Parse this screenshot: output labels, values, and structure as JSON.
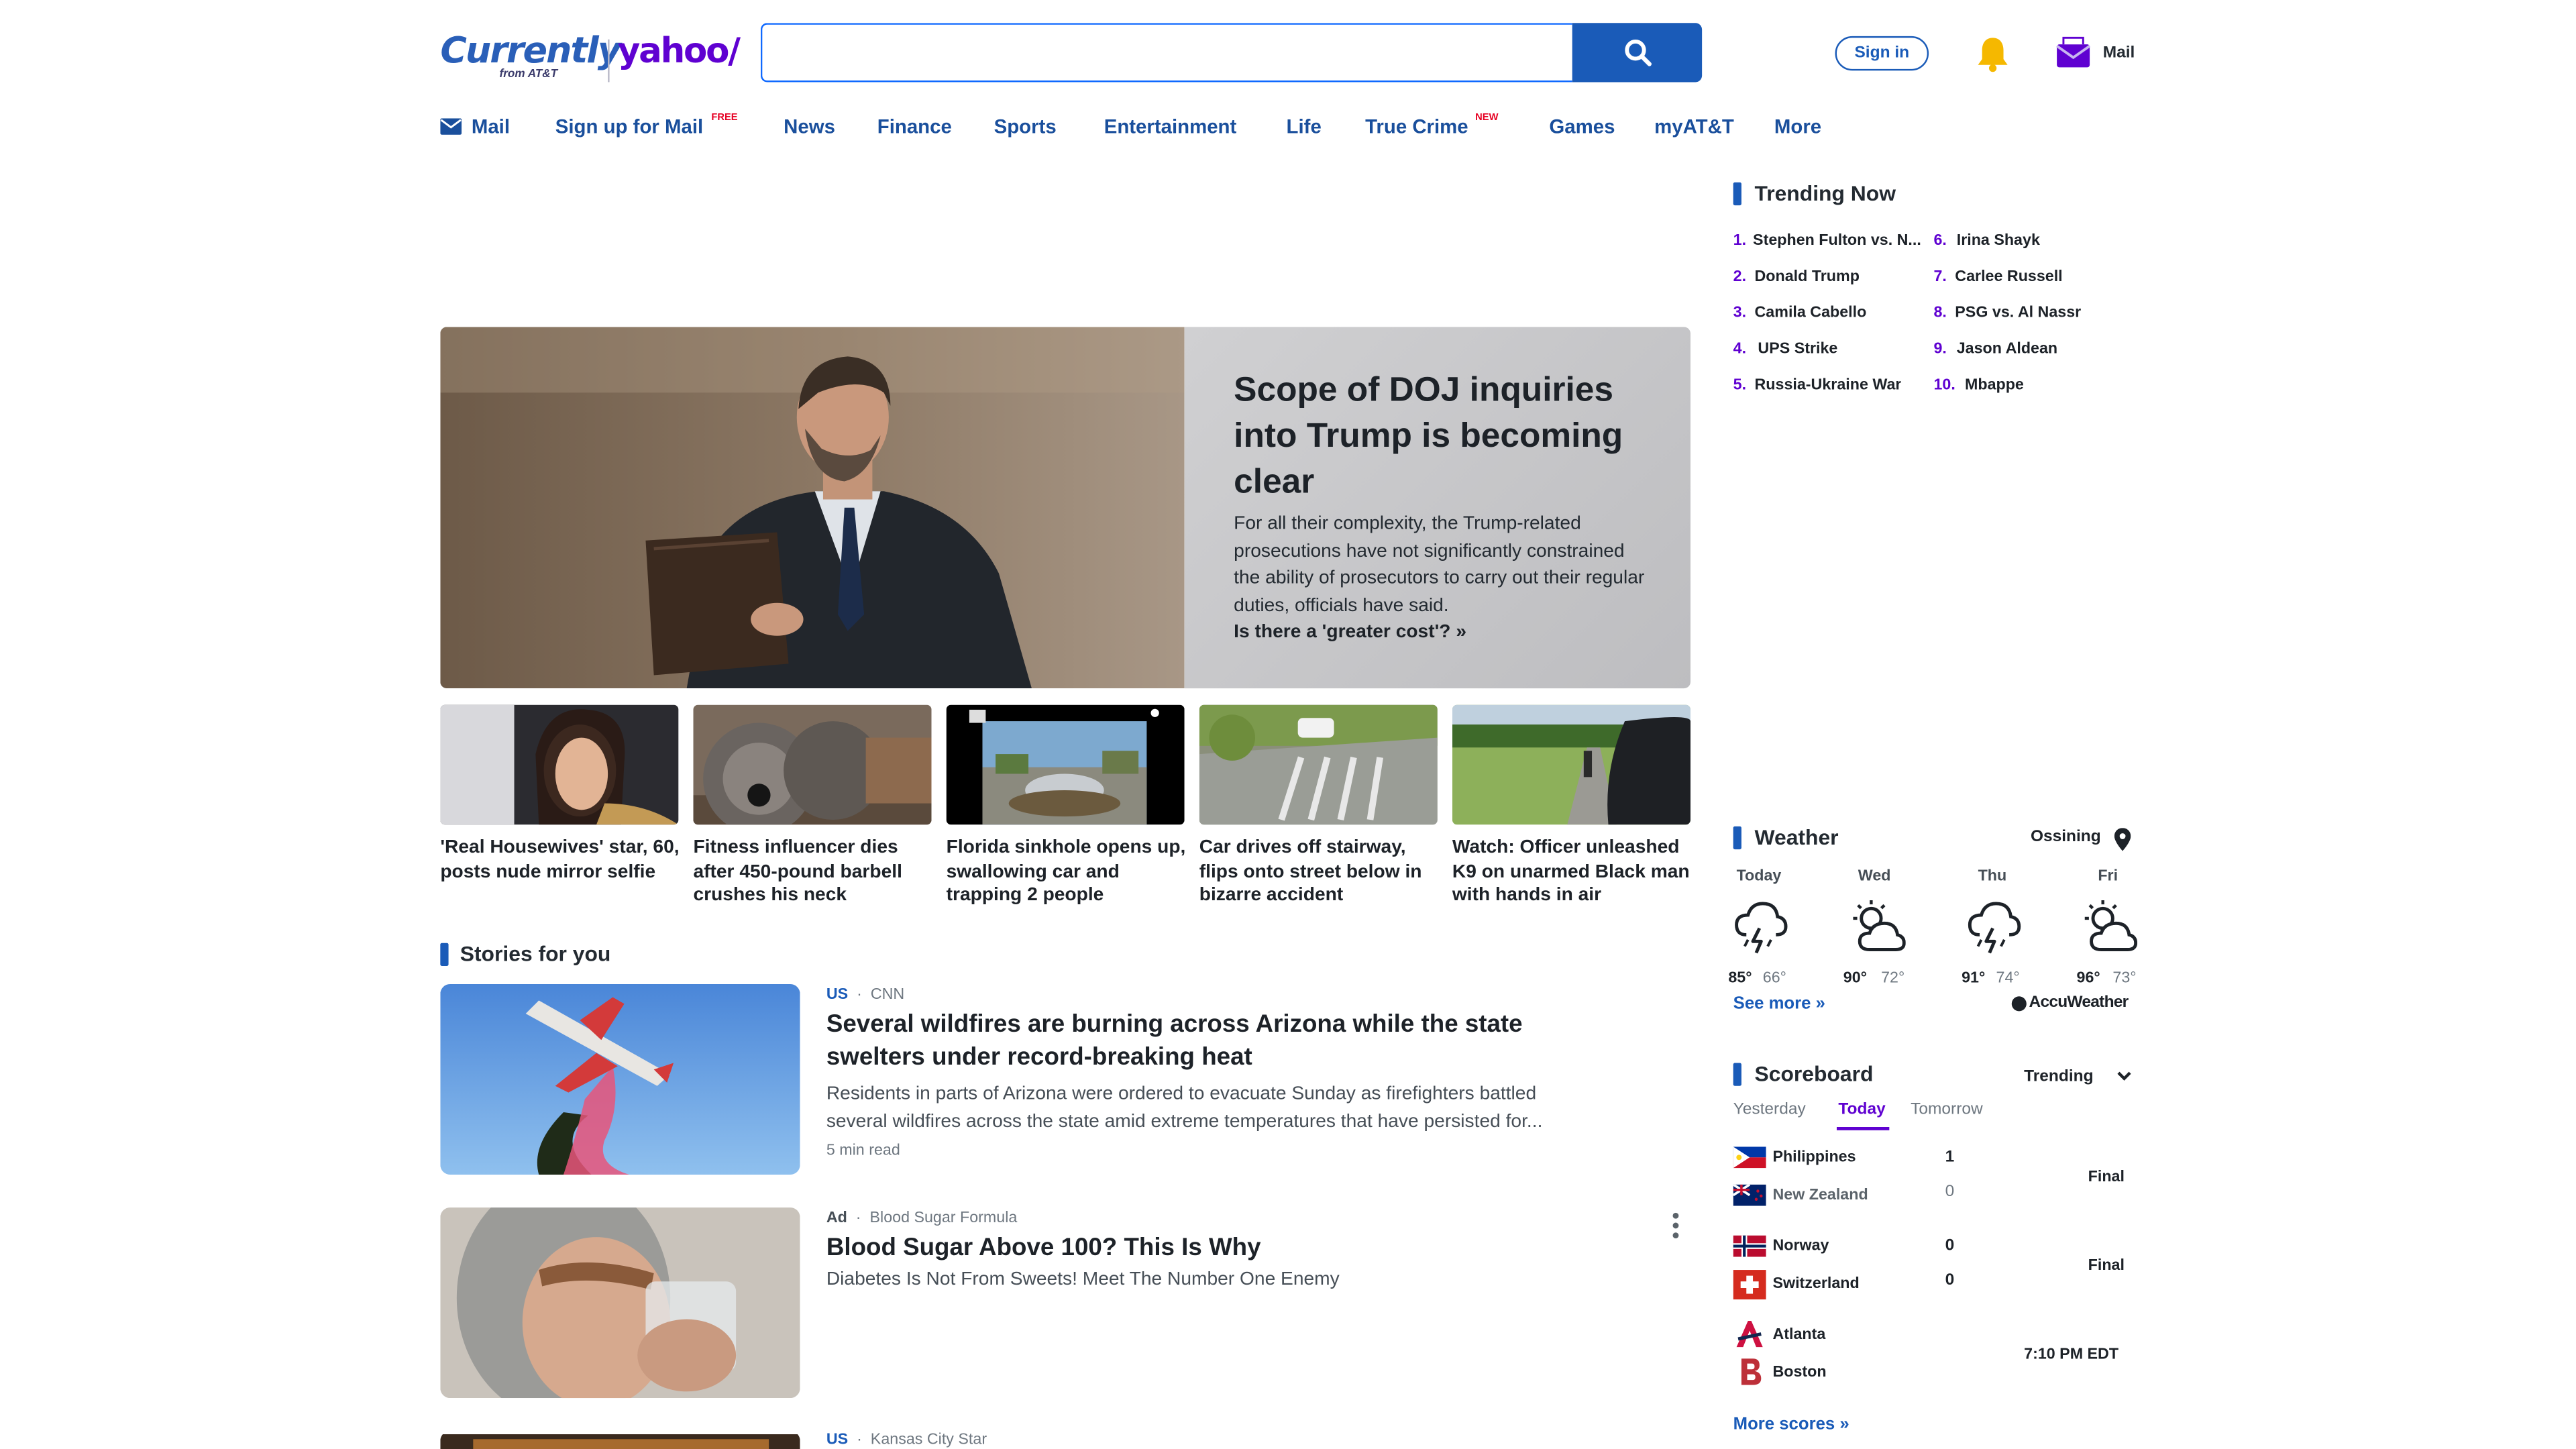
{
  "header": {
    "logo_currently": "Currently",
    "logo_att": "from AT&T",
    "logo_yahoo": "yahoo/",
    "search_placeholder": "",
    "signin_label": "Sign in",
    "mail_label": "Mail"
  },
  "nav": {
    "items": [
      {
        "label": "Mail"
      },
      {
        "label": "Sign up for Mail",
        "badge": "FREE"
      },
      {
        "label": "News"
      },
      {
        "label": "Finance"
      },
      {
        "label": "Sports"
      },
      {
        "label": "Entertainment"
      },
      {
        "label": "Life"
      },
      {
        "label": "True Crime",
        "badge": "NEW"
      },
      {
        "label": "Games"
      },
      {
        "label": "myAT&T"
      },
      {
        "label": "More"
      }
    ]
  },
  "hero": {
    "title": "Scope of DOJ inquiries into Trump is becoming clear",
    "summary": "For all their complexity, the Trump-related prosecutions have not significantly constrained the ability of prosecutors to carry out their regular duties, officials have said.",
    "link": "Is there a 'greater cost'? »"
  },
  "thumbs": [
    {
      "caption": "'Real Housewives' star, 60, posts nude mirror selfie"
    },
    {
      "caption": "Fitness influencer dies after 450-pound barbell crushes his neck"
    },
    {
      "caption": "Florida sinkhole opens up, swallowing car and trapping 2 people"
    },
    {
      "caption": "Car drives off stairway, flips onto street below in bizarre accident"
    },
    {
      "caption": "Watch: Officer unleashed K9 on unarmed Black man with hands in air"
    }
  ],
  "stories": {
    "section_title": "Stories for you",
    "items": [
      {
        "category": "US",
        "source": "CNN",
        "title": "Several wildfires are burning across Arizona while the state swelters under record-breaking heat",
        "summary": "Residents in parts of Arizona were ordered to evacuate Sunday as firefighters battled several wildfires across the state amid extreme temperatures that have persisted for...",
        "read_time": "5 min read"
      },
      {
        "category": "Ad",
        "source": "Blood Sugar Formula",
        "title": "Blood Sugar Above 100? This Is Why",
        "summary": "Diabetes Is Not From Sweets! Meet The Number One Enemy"
      },
      {
        "category": "US",
        "source": "Kansas City Star"
      }
    ]
  },
  "trending": {
    "title": "Trending Now",
    "items": [
      {
        "num": "1.",
        "label": "Stephen Fulton vs. N..."
      },
      {
        "num": "2.",
        "label": "Donald Trump"
      },
      {
        "num": "3.",
        "label": "Camila Cabello"
      },
      {
        "num": "4.",
        "label": "UPS Strike"
      },
      {
        "num": "5.",
        "label": "Russia-Ukraine War"
      },
      {
        "num": "6.",
        "label": "Irina Shayk"
      },
      {
        "num": "7.",
        "label": "Carlee Russell"
      },
      {
        "num": "8.",
        "label": "PSG vs. Al Nassr"
      },
      {
        "num": "9.",
        "label": "Jason Aldean"
      },
      {
        "num": "10.",
        "label": "Mbappe"
      }
    ]
  },
  "weather": {
    "title": "Weather",
    "location": "Ossining",
    "days": [
      {
        "day": "Today",
        "icon": "thunderstorm-icon",
        "hi": "85°",
        "lo": "66°"
      },
      {
        "day": "Wed",
        "icon": "partly-sunny-icon",
        "hi": "90°",
        "lo": "72°"
      },
      {
        "day": "Thu",
        "icon": "thunderstorm-icon",
        "hi": "91°",
        "lo": "74°"
      },
      {
        "day": "Fri",
        "icon": "partly-sunny-icon",
        "hi": "96°",
        "lo": "73°"
      }
    ],
    "see_more": "See more »",
    "provider": "AccuWeather"
  },
  "scoreboard": {
    "title": "Scoreboard",
    "filter": "Trending",
    "tabs": [
      "Yesterday",
      "Today",
      "Tomorrow"
    ],
    "active_tab": "Today",
    "games": [
      {
        "team1": "Philippines",
        "score1": "1",
        "team2": "New Zealand",
        "score2": "0",
        "status": "Final"
      },
      {
        "team1": "Norway",
        "score1": "0",
        "team2": "Switzerland",
        "score2": "0",
        "status": "Final"
      },
      {
        "team1": "Atlanta",
        "score1": "",
        "team2": "Boston",
        "score2": "",
        "status": "7:10 PM EDT"
      }
    ],
    "more_scores": "More scores »"
  },
  "colors": {
    "brand_blue": "#1a5bb8",
    "yahoo_purple": "#5f01d1",
    "badge_red": "#e60023"
  }
}
